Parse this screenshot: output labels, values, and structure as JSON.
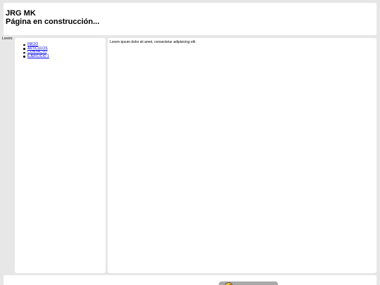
{
  "header": {
    "title": "JRG MK",
    "subtitle": "Página en construcción..."
  },
  "outer_label": "Lorem:",
  "sidebar": {
    "items": [
      {
        "label": "INICIO"
      },
      {
        "label": "ARTÍCULOS"
      },
      {
        "label": "CONTACTO"
      },
      {
        "label": "EJERCICIO 1"
      }
    ]
  },
  "content": {
    "text": "Lorem ipsum dolor sit amet, consectetur adipisicing elit."
  },
  "colors": {
    "background": "#e7e7e7",
    "panel": "#ffffff",
    "link": "#0000ee",
    "badge": "#a9a9a9"
  },
  "footer": {
    "badge_icon": "mascot-icon"
  }
}
